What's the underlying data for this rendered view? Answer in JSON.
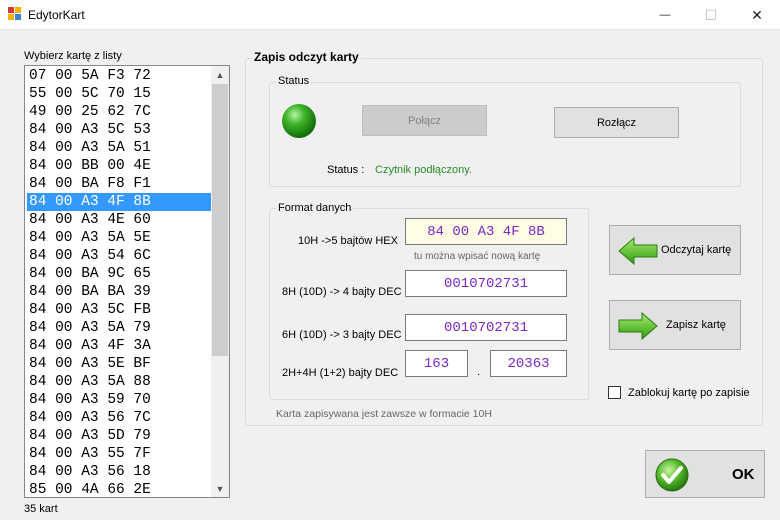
{
  "window": {
    "title": "EdytorKart",
    "minimize_glyph": "—",
    "maximize_glyph": "☐",
    "close_glyph": "✕"
  },
  "list": {
    "label": "Wybierz kartę z listy",
    "items": [
      "07 00 5A F3 72",
      "55 00 5C 70 15",
      "49 00 25 62 7C",
      "84 00 A3 5C 53",
      "84 00 A3 5A 51",
      "84 00 BB 00 4E",
      "84 00 BA F8 F1",
      "84 00 A3 4F 8B",
      "84 00 A3 4E 60",
      "84 00 A3 5A 5E",
      "84 00 A3 54 6C",
      "84 00 BA 9C 65",
      "84 00 BA BA 39",
      "84 00 A3 5C FB",
      "84 00 A3 5A 79",
      "84 00 A3 4F 3A",
      "84 00 A3 5E BF",
      "84 00 A3 5A 88",
      "84 00 A3 59 70",
      "84 00 A3 56 7C",
      "84 00 A3 5D 79",
      "84 00 A3 55 7F",
      "84 00 A3 56 18",
      "85 00 4A 66 2E"
    ],
    "selected_index": 7,
    "count_label": "35 kart",
    "scroll_up": "▲",
    "scroll_down": "▼"
  },
  "main_group": {
    "label": "Zapis odczyt karty"
  },
  "status_group": {
    "label": "Status",
    "connect_button": "Połącz",
    "disconnect_button": "Rozłącz",
    "status_key": "Status :",
    "status_value": "Czytnik podłączony.",
    "colors": {
      "led": "#2e9e1f",
      "status_text": "#2a8a2a"
    }
  },
  "format_group": {
    "label": "Format danych",
    "hex_label": "10H ->5 bajtów HEX",
    "hex_value": "84 00 A3 4F 8B",
    "hex_hint": "tu można wpisać nową kartę",
    "dec8_label": "8H (10D) -> 4 bajty DEC",
    "dec8_value": "0010702731",
    "dec6_label": "6H (10D) -> 3 bajty DEC",
    "dec6_value": "0010702731",
    "dec2_label": "2H+4H (1+2) bajty DEC",
    "dec2_a": "163",
    "dec2_sep": ".",
    "dec2_b": "20363"
  },
  "footer_note": "Karta zapisywana jest zawsze w formacie 10H",
  "actions": {
    "read_button": "Odczytaj kartę",
    "write_button": "Zapisz kartę",
    "lock_checkbox_label": "Zablokuj kartę po zapisie",
    "lock_checked": false,
    "ok_button": "OK"
  }
}
